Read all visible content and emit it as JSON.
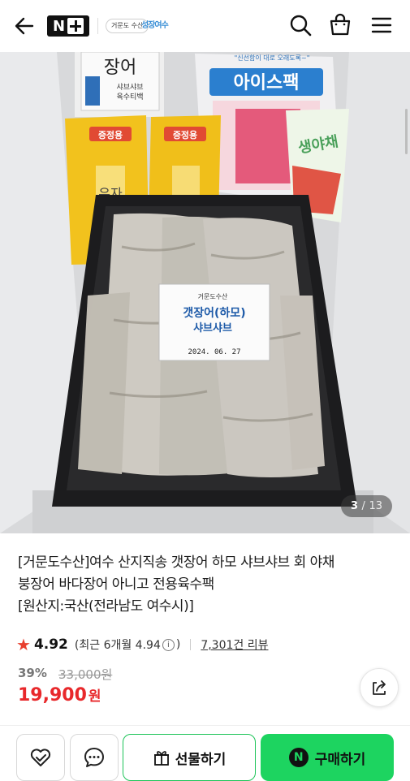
{
  "header": {
    "nplus_logo": "N",
    "store_logo": "거문도 수산",
    "local_logo": "성장여수"
  },
  "gallery": {
    "current": "3",
    "total": "13",
    "separator": "/",
    "package_text": {
      "eel_box_line1": "장어",
      "eel_box_line2": "샤브샤브",
      "eel_box_line3": "육수티백",
      "icepack": "아이스팩",
      "icepack_slogan": "\"신선함이 대로 오래도록~\"",
      "yuzu_tag1": "증정용",
      "yuzu_tag2": "증정용",
      "yuzu_label": "유자",
      "vegetable_label": "생야채",
      "tray_brand": "거문도수산",
      "tray_name": "갯장어(하모)",
      "tray_name2": "샤브샤브",
      "tray_date": "2024. 06. 27"
    }
  },
  "product": {
    "title_line1": "[거문도수산]여수 산지직송 갯장어 하모 샤브샤브 회 야채",
    "title_line2": "붕장어 바다장어 아니고 전용육수팩",
    "title_line3": "[원산지:국산(전라남도 여수시)]",
    "rating": "4.92",
    "recent_label": "(최근 6개월 4.94",
    "recent_close": ")",
    "info_symbol": "i",
    "review_count": "7,301건 리뷰",
    "discount": "39%",
    "original_price": "33,000원",
    "price": "19,900",
    "currency": "원"
  },
  "actions": {
    "gift_label": "선물하기",
    "buy_label": "구매하기",
    "npay_badge": "N"
  },
  "colors": {
    "price_red": "#e8282b",
    "star_red": "#e8402f",
    "naver_green": "#1dd460",
    "gift_border": "#1dc458"
  }
}
